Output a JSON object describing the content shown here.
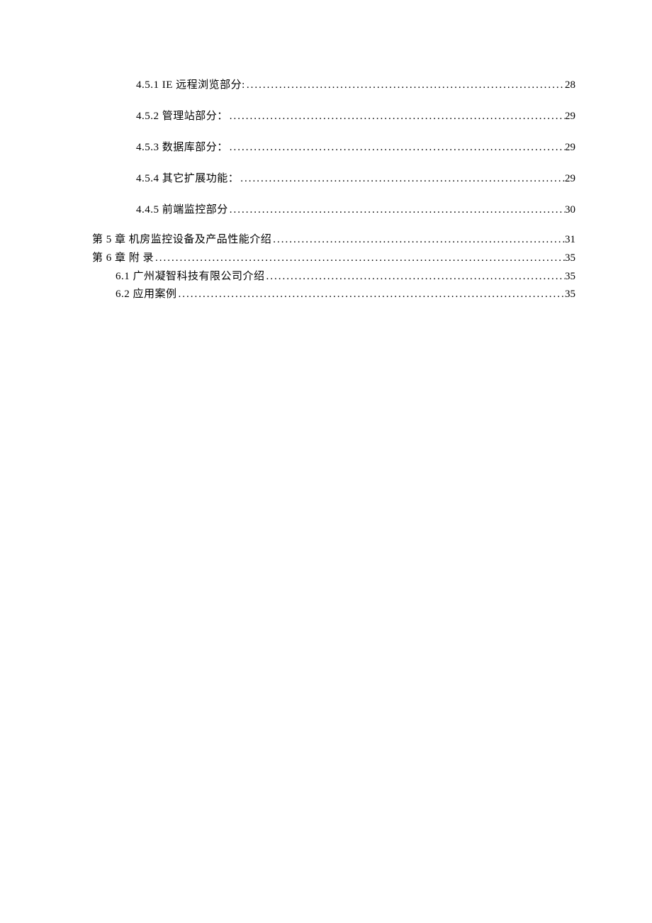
{
  "toc": [
    {
      "level": "l3",
      "label": "4.5.1 IE 远程浏览部分:",
      "page": "28"
    },
    {
      "level": "l3",
      "label": "4.5.2 管理站部分：",
      "page": "29"
    },
    {
      "level": "l3",
      "label": "4.5.3 数据库部分：",
      "page": "29"
    },
    {
      "level": "l3",
      "label": "4.5.4 其它扩展功能：",
      "page": "29"
    },
    {
      "level": "l3",
      "label": "4.4.5  前端监控部分",
      "page": "30"
    },
    {
      "level": "l1",
      "label": "第 5 章 机房监控设备及产品性能介绍",
      "page": "31"
    },
    {
      "level": "l1",
      "label": "第 6 章 附 录",
      "page": "35"
    },
    {
      "level": "l2",
      "label": "6.1 广州凝智科技有限公司介绍",
      "page": "35"
    },
    {
      "level": "l2",
      "label": "6.2 应用案例",
      "page": "35"
    }
  ]
}
